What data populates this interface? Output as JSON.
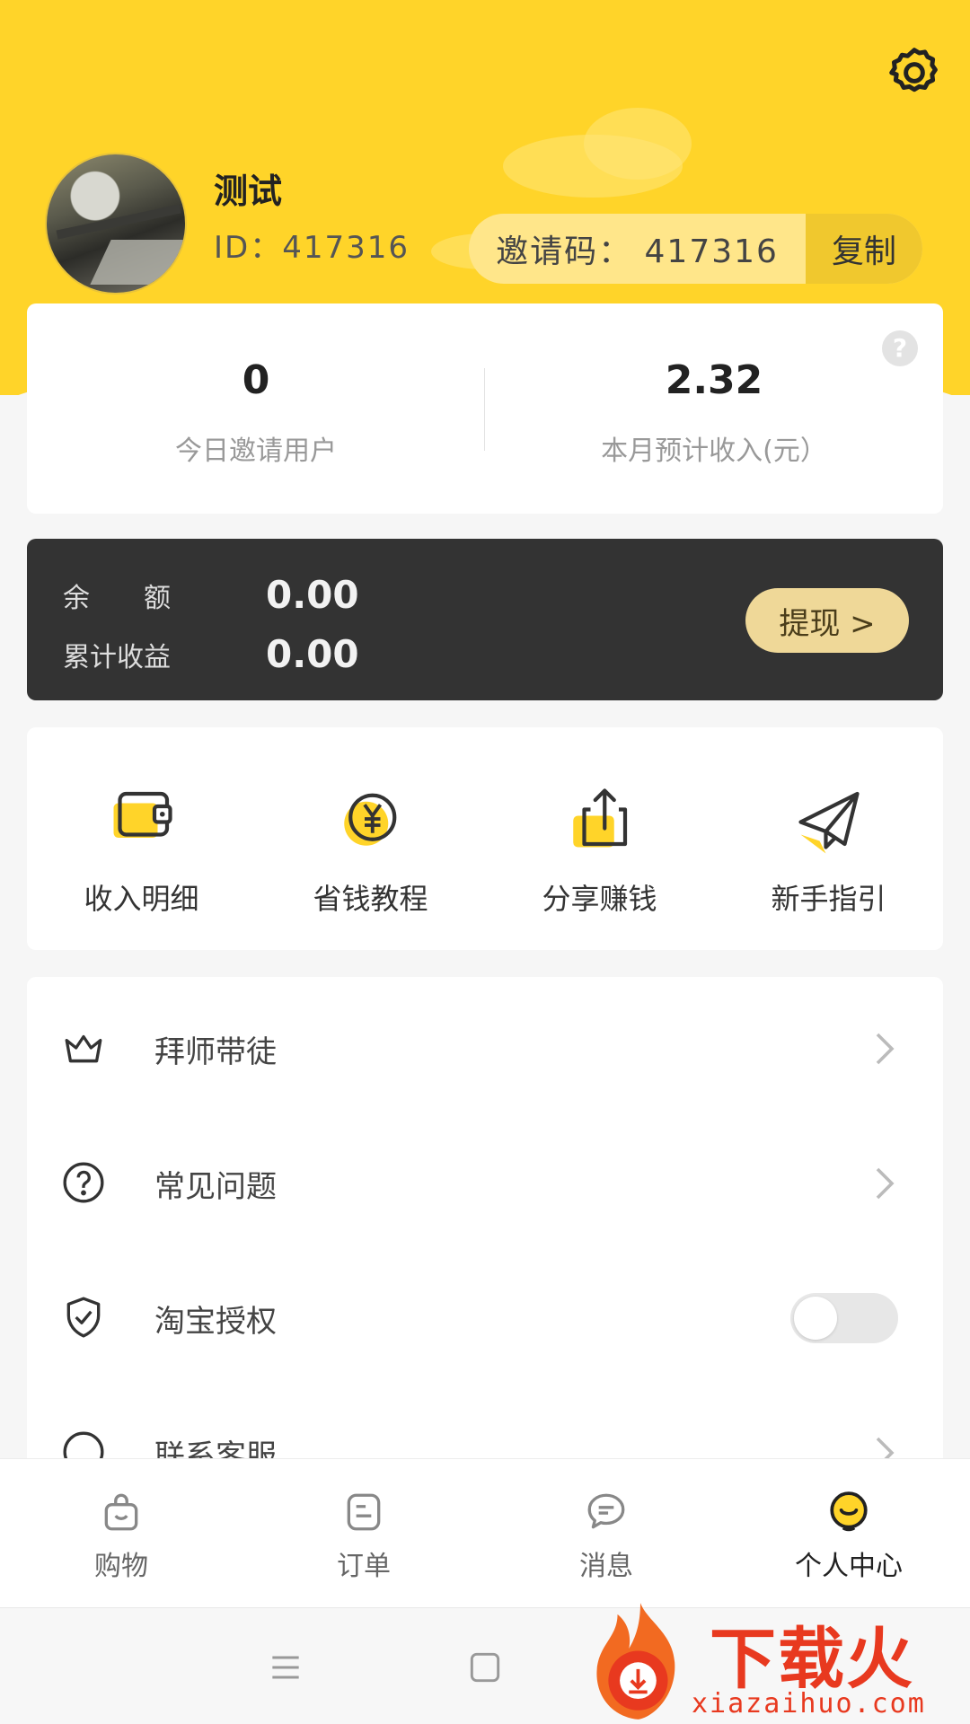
{
  "header": {
    "settings_icon": "gear-icon",
    "user_name": "测试",
    "user_id": "ID：417316",
    "invite_code_text": "邀请码： 417316",
    "copy_label": "复制"
  },
  "stats": {
    "help_icon": "question-icon",
    "help_glyph": "?",
    "items": [
      {
        "value": "0",
        "label": "今日邀请用户"
      },
      {
        "value": "2.32",
        "label": "本月预计收入(元）"
      }
    ]
  },
  "balance": {
    "rows": [
      {
        "label": "余　　额",
        "value": "0.00"
      },
      {
        "label": "累计收益",
        "value": "0.00"
      }
    ],
    "withdraw_label": "提现 >"
  },
  "quick_actions": [
    {
      "label": "收入明细",
      "icon": "wallet-icon"
    },
    {
      "label": "省钱教程",
      "icon": "yuan-coin-icon"
    },
    {
      "label": "分享赚钱",
      "icon": "share-icon"
    },
    {
      "label": "新手指引",
      "icon": "paper-plane-icon"
    }
  ],
  "menu": [
    {
      "label": "拜师带徒",
      "icon": "crown-icon",
      "control": "chevron"
    },
    {
      "label": "常见问题",
      "icon": "question-circle-icon",
      "control": "chevron"
    },
    {
      "label": "淘宝授权",
      "icon": "shield-check-icon",
      "control": "toggle",
      "toggle_on": false
    },
    {
      "label": "联系客服",
      "icon": "service-icon",
      "control": "chevron"
    }
  ],
  "tabbar": [
    {
      "label": "购物",
      "icon": "shopping-bag-icon",
      "active": false
    },
    {
      "label": "订单",
      "icon": "order-icon",
      "active": false
    },
    {
      "label": "消息",
      "icon": "message-icon",
      "active": false
    },
    {
      "label": "个人中心",
      "icon": "smile-face-icon",
      "active": true
    }
  ],
  "colors": {
    "brand_yellow": "#ffd429",
    "dark_card": "#333333",
    "withdraw_bg": "#efd898",
    "watermark_red": "#e8391f"
  },
  "watermark": {
    "brand": "下载火",
    "url": "xiazaihuo.com"
  }
}
